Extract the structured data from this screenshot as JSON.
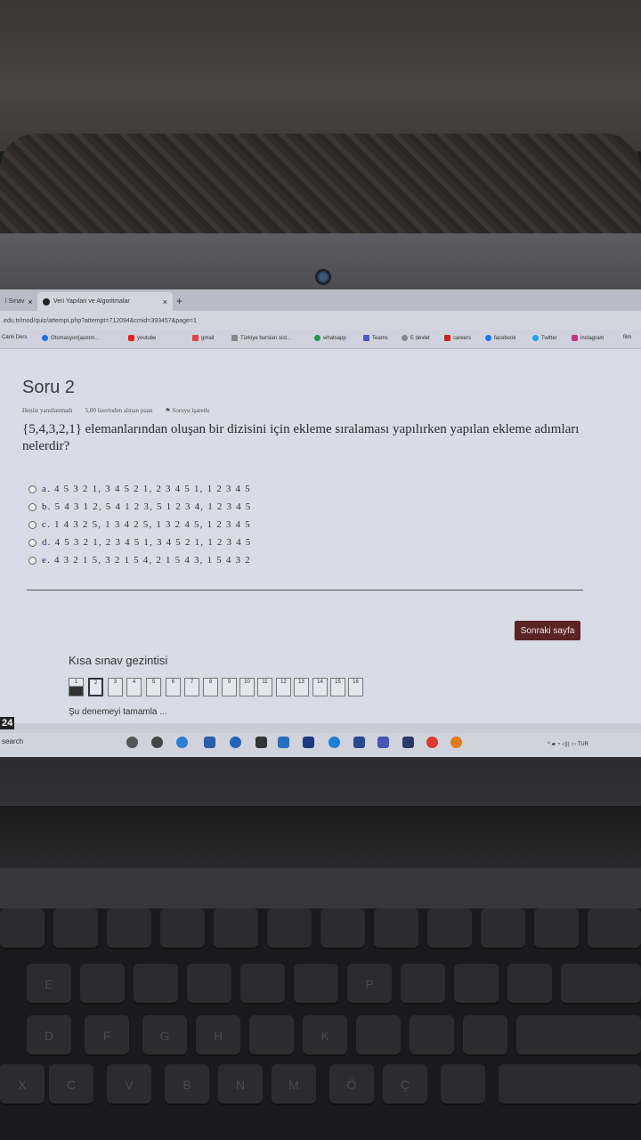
{
  "browser": {
    "tabs": [
      {
        "label": "l Sınav",
        "close": "×"
      },
      {
        "label": "Veri Yapıları ve Algoritmalar",
        "close": "×"
      }
    ],
    "new_tab": "+",
    "url": ".edu.tr/mod/quiz/attempt.php?attempt=712094&cmid=393457&page=1",
    "bookmarks": [
      {
        "label": "Canlı Ders",
        "color": "#1a73e8"
      },
      {
        "label": "Otomasyon(autom...",
        "color": "#1a73e8"
      },
      {
        "label": "youtube",
        "color": "#e02020"
      },
      {
        "label": "gmail",
        "color": "#d44"
      },
      {
        "label": "Türkiye bursları sist...",
        "color": "#888"
      },
      {
        "label": "whatsapp",
        "color": "#1b9c4a"
      },
      {
        "label": "Teams",
        "color": "#5059c9"
      },
      {
        "label": "E devlet",
        "color": "#888"
      },
      {
        "label": "careers",
        "color": "#c22"
      },
      {
        "label": "facebook",
        "color": "#1877f2"
      },
      {
        "label": "Twitter",
        "color": "#1da1f2"
      },
      {
        "label": "instagram",
        "color": "#c13584"
      },
      {
        "label": "film",
        "color": "#666"
      }
    ]
  },
  "question": {
    "title": "Soru 2",
    "status": "Henüz yanıtlanmadı",
    "points": "5,00 üzerinden alınan puan",
    "flag": "Soruyu işaretle",
    "text": "{5,4,3,2,1} elemanlarından oluşan bir dizisini için ekleme sıralaması yapılırken yapılan ekleme adımları nelerdir?",
    "options": [
      "a. 4 5 3 2 1, 3 4 5 2 1, 2 3 4 5 1, 1 2 3 4 5",
      "b. 5 4 3 1 2, 5 4 1 2 3, 5 1 2 3 4, 1 2 3 4 5",
      "c. 1 4 3 2 5, 1 3 4 2 5, 1 3 2 4 5, 1 2 3 4 5",
      "d. 4 5 3 2 1, 2 3 4 5 1, 3 4 5 2 1, 1 2 3 4 5",
      "e. 4 3 2 1 5, 3 2 1 5 4, 2 1 5 4 3, 1 5 4 3 2"
    ]
  },
  "next_button": "Sonraki sayfa",
  "quiz_nav": {
    "title": "Kısa sınav gezintisi",
    "items": [
      "1",
      "2",
      "3",
      "4",
      "5",
      "6",
      "7",
      "8",
      "9",
      "10",
      "11",
      "12",
      "13",
      "14",
      "15",
      "16"
    ],
    "finish": "Şu denemeyi tamamla ..."
  },
  "taskbar": {
    "temperature": "24",
    "search": "search",
    "tray": "TUR"
  },
  "keyboard": {
    "row1": [
      "",
      "",
      "",
      "",
      "",
      "",
      "",
      "",
      "",
      "",
      "",
      ""
    ],
    "row2": [
      "E",
      "",
      "",
      "",
      "",
      "",
      "",
      "",
      "P",
      "",
      ""
    ],
    "row3": [
      "D",
      "F",
      "G",
      "H",
      "",
      "K",
      "",
      "",
      "",
      ""
    ],
    "row4": [
      "X",
      "C",
      "V",
      "B",
      "N",
      "M",
      "Ö",
      "Ç",
      "",
      ""
    ]
  }
}
